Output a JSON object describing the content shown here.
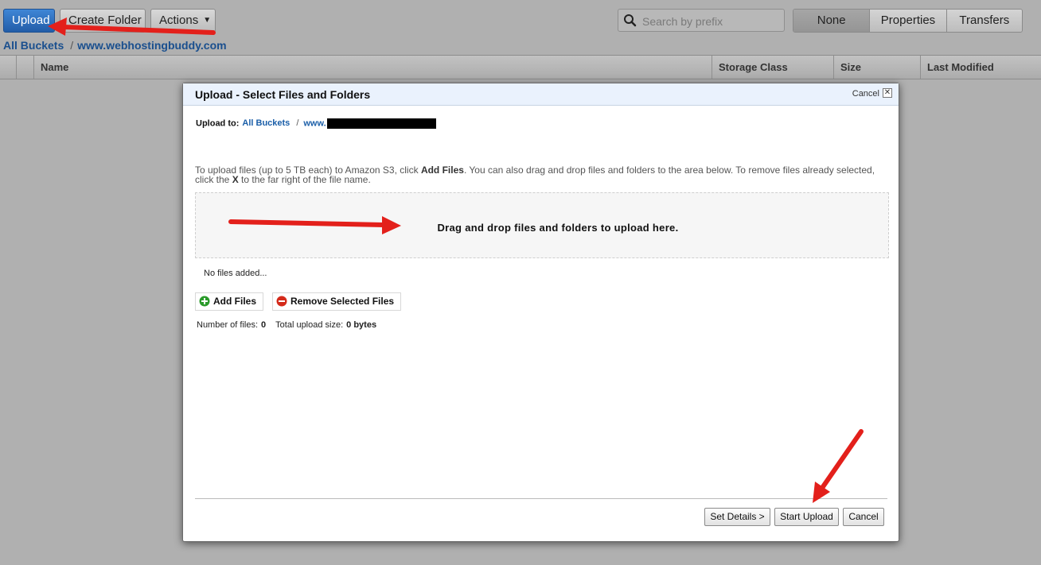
{
  "toolbar": {
    "upload_label": "Upload",
    "create_folder_label": "Create Folder",
    "actions_label": "Actions",
    "search_placeholder": "Search by prefix",
    "view_options": [
      "None",
      "Properties",
      "Transfers"
    ],
    "selected_view": "None"
  },
  "breadcrumb": {
    "root": "All Buckets",
    "separator": "/",
    "bucket": "www.webhostingbuddy.com"
  },
  "table": {
    "columns": [
      "Name",
      "Storage Class",
      "Size",
      "Last Modified"
    ]
  },
  "modal": {
    "title": "Upload - Select Files and Folders",
    "cancel_label": "Cancel",
    "close_glyph": "✕",
    "upload_to_label": "Upload to:",
    "upload_to_root": "All Buckets",
    "upload_to_sep": "/",
    "upload_to_bucket": "www.",
    "instructions": {
      "p1": "To upload files (up to 5 TB each) to Amazon S3, click ",
      "b1": "Add Files",
      "p2": ". You can also drag and drop files and folders to the area below. To remove files already selected, click the ",
      "b2": "X",
      "p3": " to the far right of the file name."
    },
    "drop_text": "Drag and drop files and folders to upload here.",
    "no_files_text": "No files added...",
    "add_files_label": "Add Files",
    "remove_files_label": "Remove Selected Files",
    "num_files_label": "Number of files:",
    "num_files_value": "0",
    "total_size_label": "Total upload size:",
    "total_size_value": "0 bytes",
    "set_details_label": "Set Details >",
    "start_upload_label": "Start Upload",
    "footer_cancel_label": "Cancel"
  },
  "colors": {
    "primary_button": "#2f73c4",
    "link": "#1a4f8e",
    "annotation_arrow": "#e3201b",
    "add_icon": "#2a9a2a",
    "remove_icon": "#d42a1a"
  }
}
